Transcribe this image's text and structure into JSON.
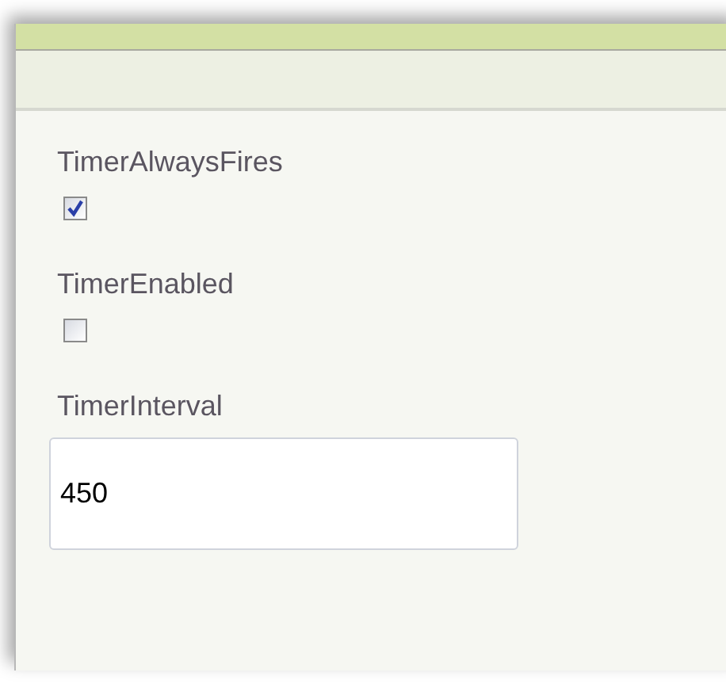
{
  "properties": [
    {
      "kind": "checkbox",
      "label": "TimerAlwaysFires",
      "checked": true
    },
    {
      "kind": "checkbox",
      "label": "TimerEnabled",
      "checked": false
    },
    {
      "kind": "text",
      "label": "TimerInterval",
      "value": "450"
    }
  ]
}
